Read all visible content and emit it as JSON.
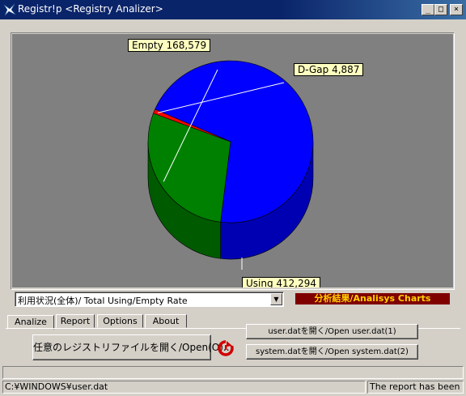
{
  "window": {
    "title": "Registr!p  <Registry Analizer>",
    "controls": {
      "minimize": "_",
      "maximize": "□",
      "close": "×"
    }
  },
  "chart_data": {
    "type": "pie",
    "slices": [
      {
        "label": "Using",
        "value": 412294,
        "display": "Using 412,294",
        "color": "#0000ff"
      },
      {
        "label": "Empty",
        "value": 168579,
        "display": "Empty 168,579",
        "color": "#008000"
      },
      {
        "label": "D-Gap",
        "value": 4887,
        "display": "D-Gap 4,887",
        "color": "#ff0000"
      }
    ],
    "style": "3d",
    "background": "#808080"
  },
  "controls": {
    "chart_select": "利用状況(全体)/ Total Using/Empty Rate",
    "banner": "分析結果/Analisys Charts"
  },
  "tabs": [
    {
      "label": "Analize",
      "active": true
    },
    {
      "label": "Report",
      "active": false
    },
    {
      "label": "Options",
      "active": false
    },
    {
      "label": "About",
      "active": false
    }
  ],
  "buttons": {
    "open_any": "任意のレジストリファイルを開く/Open(O)...",
    "open_user": "user.datを開く/Open user.dat(1)",
    "open_system": "system.datを開く/Open system.dat(2)"
  },
  "status": {
    "path": "C:¥WINDOWS¥user.dat",
    "message": "The report has been m"
  }
}
